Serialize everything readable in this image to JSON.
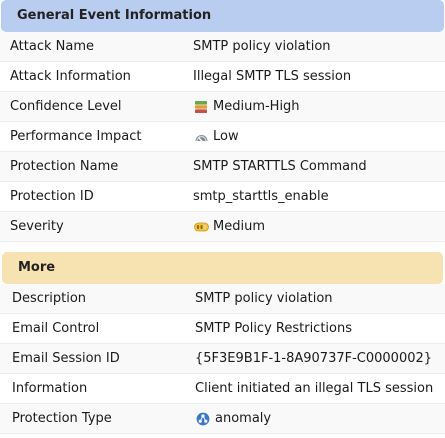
{
  "general": {
    "title": "General Event Information",
    "rows": [
      {
        "label": "Attack Name",
        "value": "SMTP policy violation"
      },
      {
        "label": "Attack Information",
        "value": "Illegal SMTP TLS session"
      },
      {
        "label": "Confidence Level",
        "value": "Medium-High",
        "icon": "confidence-level-icon"
      },
      {
        "label": "Performance Impact",
        "value": "Low",
        "icon": "gauge-icon"
      },
      {
        "label": "Protection Name",
        "value": "SMTP STARTTLS Command"
      },
      {
        "label": "Protection ID",
        "value": "smtp_starttls_enable"
      },
      {
        "label": "Severity",
        "value": "Medium",
        "icon": "severity-medium-icon"
      }
    ]
  },
  "more": {
    "title": "More",
    "rows": [
      {
        "label": "Description",
        "value": "SMTP policy violation"
      },
      {
        "label": "Email Control",
        "value": "SMTP Policy Restrictions"
      },
      {
        "label": "Email Session ID",
        "value": "{5F3E9B1F-1-8A90737F-C0000002}"
      },
      {
        "label": "Information",
        "value": "Client initiated an illegal TLS session"
      },
      {
        "label": "Protection Type",
        "value": "anomaly",
        "icon": "anomaly-icon"
      }
    ]
  },
  "colors": {
    "general_header": "#b9cdf0",
    "more_header": "#f7e2b2"
  }
}
